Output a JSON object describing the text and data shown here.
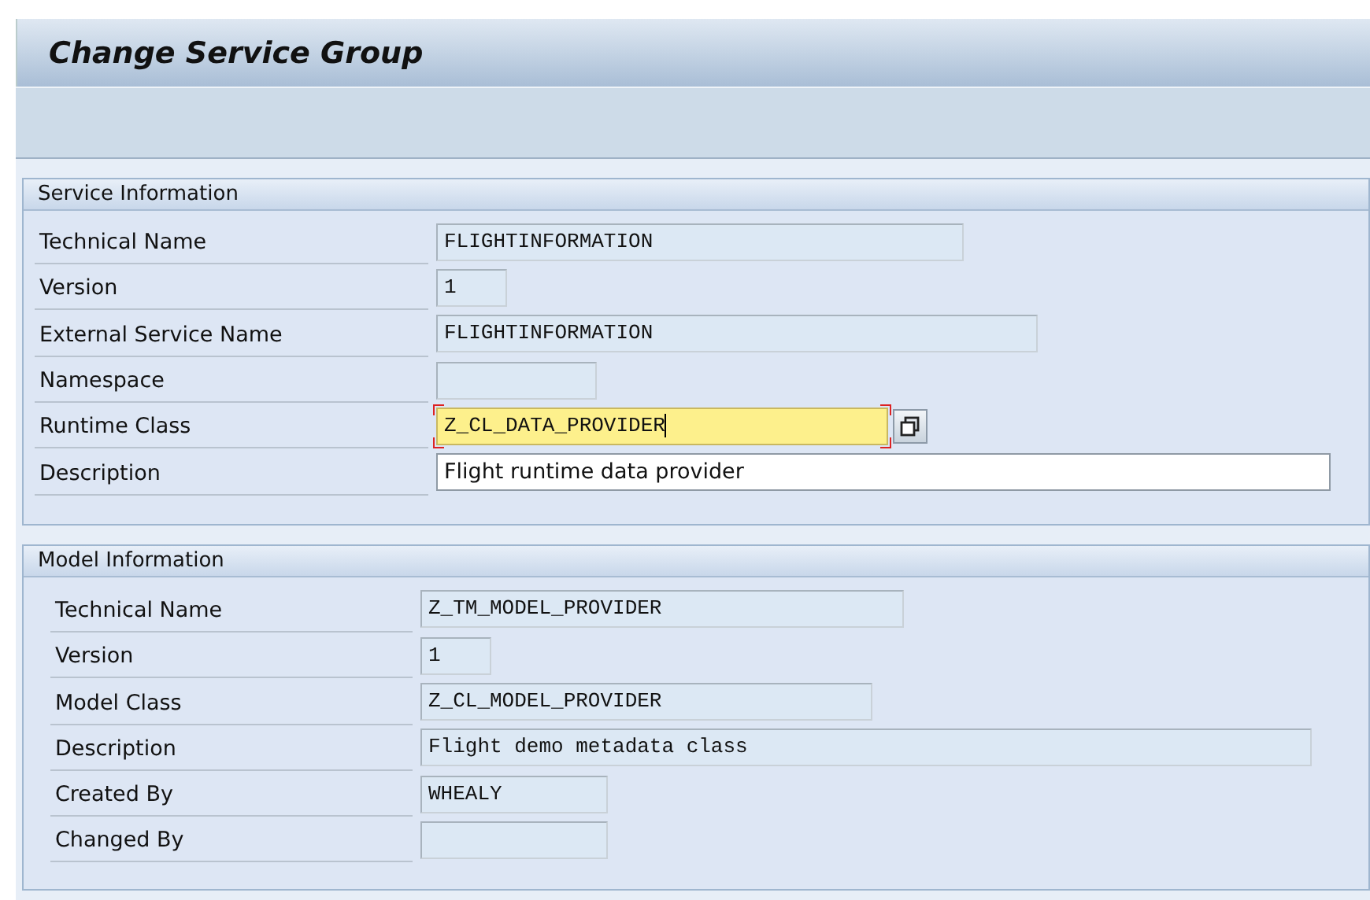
{
  "window": {
    "title": "Change Service Group"
  },
  "sections": [
    {
      "title": "Service Information",
      "fields": [
        {
          "label": "Technical Name",
          "value": "FLIGHTINFORMATION",
          "kind": "display"
        },
        {
          "label": "Version",
          "value": "1",
          "kind": "display"
        },
        {
          "label": "External Service Name",
          "value": "FLIGHTINFORMATION",
          "kind": "display"
        },
        {
          "label": "Namespace",
          "kind": "display"
        },
        {
          "label": "Runtime Class",
          "value": "Z_CL_DATA_PROVIDER",
          "kind": "focused"
        },
        {
          "label": "Description",
          "value": "Flight runtime data provider",
          "kind": "input"
        }
      ]
    },
    {
      "title": "Model Information",
      "fields": [
        {
          "label": "Technical Name",
          "value": "Z_TM_MODEL_PROVIDER",
          "kind": "display"
        },
        {
          "label": "Version",
          "value": "1",
          "kind": "display"
        },
        {
          "label": "Model Class",
          "value": "Z_CL_MODEL_PROVIDER",
          "kind": "display"
        },
        {
          "label": "Description",
          "value": "Flight demo metadata class",
          "kind": "display"
        },
        {
          "label": "Created By",
          "value": "WHEALY",
          "kind": "display"
        },
        {
          "label": "Changed By",
          "kind": "display"
        }
      ]
    }
  ]
}
